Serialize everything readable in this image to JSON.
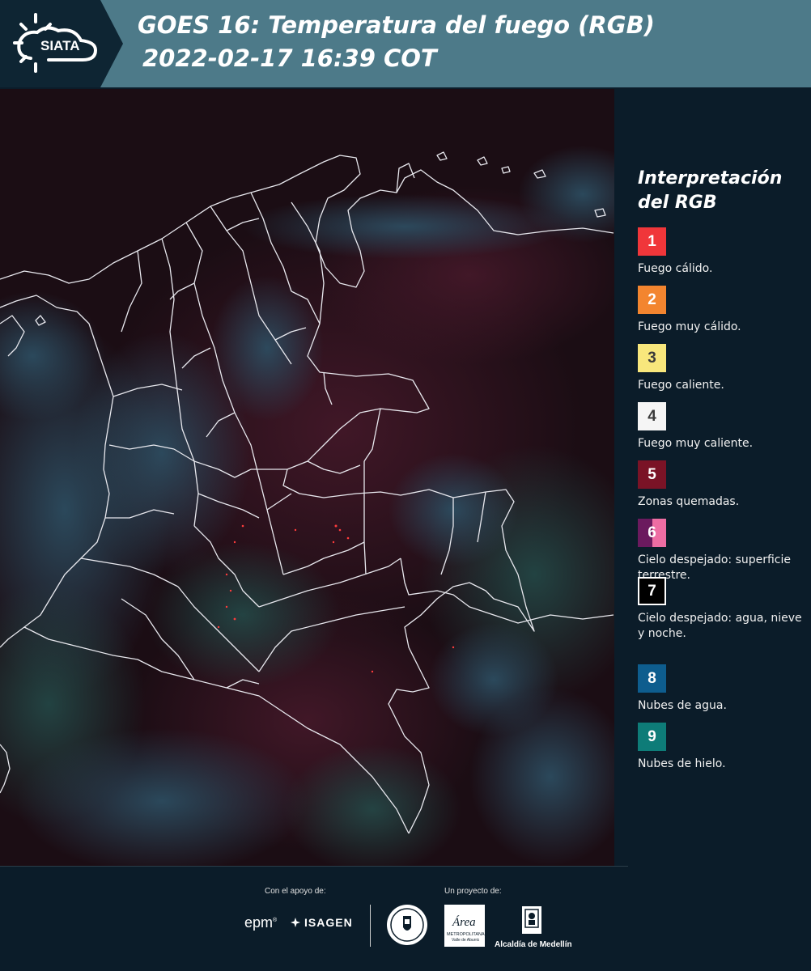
{
  "header": {
    "logo_text": "SIATA",
    "title_line1": "GOES 16: Temperatura del fuego (RGB)",
    "title_line2": "2022-02-17 16:39 COT",
    "background_color": "#4d7a89"
  },
  "legend": {
    "title": "Interpretación del RGB",
    "items": [
      {
        "number": "1",
        "label": "Fuego cálido.",
        "color": "#f0363a",
        "text_color": "#ffffff"
      },
      {
        "number": "2",
        "label": "Fuego muy cálido.",
        "color": "#f3852f",
        "text_color": "#ffffff"
      },
      {
        "number": "3",
        "label": "Fuego caliente.",
        "color": "#f8e77c",
        "text_color": "#3a3a3a"
      },
      {
        "number": "4",
        "label": "Fuego muy caliente.",
        "color": "#f5f5f5",
        "text_color": "#3a3a3a"
      },
      {
        "number": "5",
        "label": "Zonas quemadas.",
        "color": "#7a1326",
        "text_color": "#ffffff"
      },
      {
        "number": "6",
        "label": "Cielo despejado: superficie terrestre.",
        "color": "#6b1a5e",
        "color_secondary": "#ee6da3",
        "text_color": "#ffffff"
      },
      {
        "number": "7",
        "label": "Cielo despejado: agua, nieve y noche.",
        "color": "#000000",
        "border_color": "#ffffff",
        "text_color": "#ffffff"
      },
      {
        "number": "8",
        "label": "Nubes de agua.",
        "color": "#0e5d8e",
        "text_color": "#ffffff"
      },
      {
        "number": "9",
        "label": "Nubes de hielo.",
        "color": "#0e7c78",
        "text_color": "#ffffff"
      }
    ]
  },
  "footer": {
    "support_label": "Con el apoyo de:",
    "project_label": "Un proyecto de:",
    "epm_text": "epm",
    "isagen_text": "ISAGEN",
    "area_text_1": "Área",
    "area_text_2": "METROPOLITANA",
    "area_text_3": "Valle de Aburrá",
    "medellin_text": "Alcaldía de Medellín"
  }
}
